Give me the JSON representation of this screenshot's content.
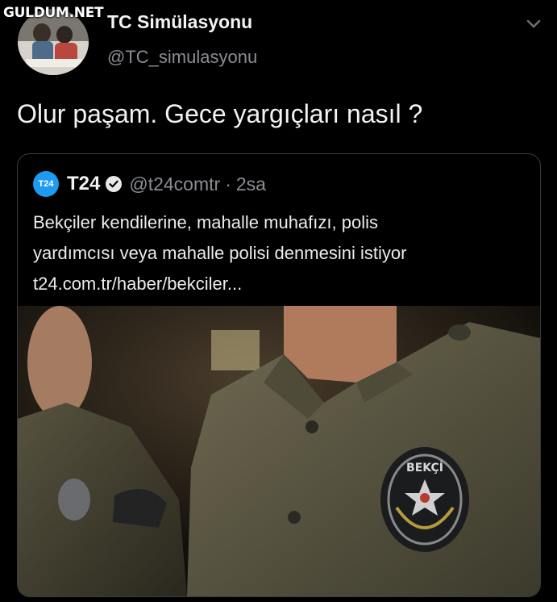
{
  "watermark": "GULDUM.NET",
  "tweet": {
    "display_name": "TC Simülasyonu",
    "handle": "@TC_simulasyonu",
    "text": "Olur paşam. Gece yargıçları nasıl ?"
  },
  "quote": {
    "logo_text": "T24",
    "name": "T24",
    "handle": "@t24comtr",
    "separator": "·",
    "time": "2sa",
    "lines": [
      "Bekçiler kendilerine, mahalle muhafızı, polis",
      "yardımcısı veya mahalle polisi denmesini istiyor",
      "t24.com.tr/haber/bekciler..."
    ],
    "image_badge_text": "BEKÇİ"
  },
  "icons": {
    "menu": "chevron-down-icon",
    "verified": "verified-badge-icon"
  },
  "colors": {
    "background": "#000000",
    "muted_text": "#8a8d91",
    "accent": "#1d9bf0",
    "card_border": "#3a3d40"
  }
}
